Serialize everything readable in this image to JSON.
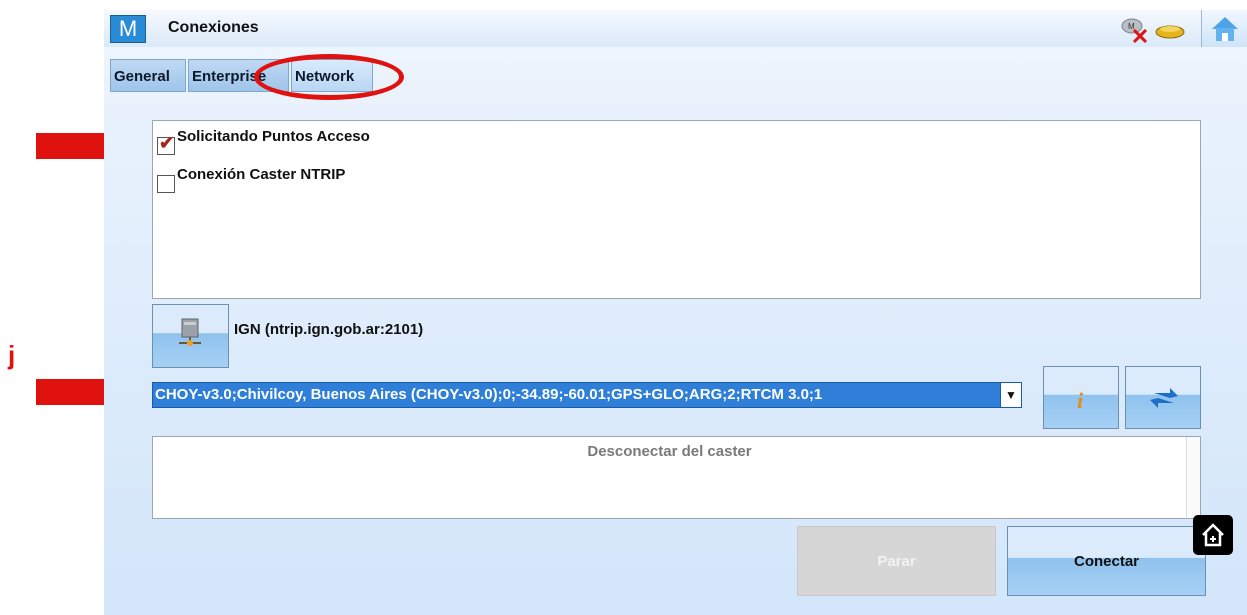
{
  "window": {
    "title": "Conexiones",
    "logo_letter": "M"
  },
  "status_icons": [
    "modem-disconnected-icon",
    "receiver-icon",
    "home-icon"
  ],
  "tabs": [
    {
      "label": "General",
      "active": false
    },
    {
      "label": "Enterprise",
      "active": false
    },
    {
      "label": "Network",
      "active": true
    }
  ],
  "options": [
    {
      "label": "Solicitando Puntos Acceso",
      "checked": true
    },
    {
      "label": "Conexión Caster NTRIP",
      "checked": false
    }
  ],
  "server": {
    "label": "IGN (ntrip.ign.gob.ar:2101)"
  },
  "mountpoint": {
    "selected": "CHOY-v3.0;Chivilcoy, Buenos Aires (CHOY-v3.0);0;-34.89;-60.01;GPS+GLO;ARG;2;RTCM 3.0;1"
  },
  "message": {
    "text": "Desconectar del caster"
  },
  "buttons": {
    "stop_label": "Parar",
    "connect_label": "Conectar"
  },
  "annotations": {
    "j_label": "j",
    "color": "#e0120f"
  }
}
